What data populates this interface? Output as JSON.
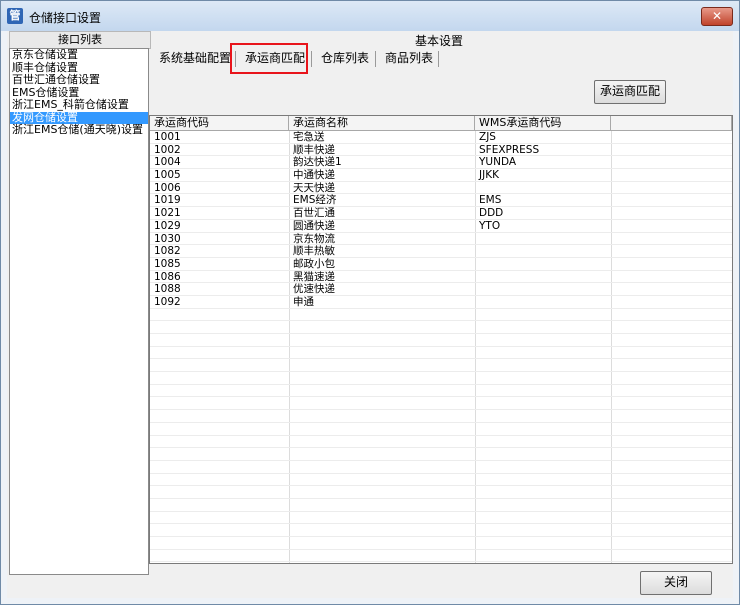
{
  "window": {
    "title": "仓储接口设置",
    "app_icon_glyph": "管",
    "close_glyph": "✕"
  },
  "left_panel": {
    "header": "接口列表",
    "items": [
      {
        "label": "京东仓储设置",
        "selected": false
      },
      {
        "label": "顺丰仓储设置",
        "selected": false
      },
      {
        "label": "百世汇通仓储设置",
        "selected": false
      },
      {
        "label": "EMS仓储设置",
        "selected": false
      },
      {
        "label": "浙江EMS_科箭仓储设置",
        "selected": false
      },
      {
        "label": "发网仓储设置",
        "selected": true
      },
      {
        "label": "浙江EMS仓储(通天晓)设置",
        "selected": false
      }
    ]
  },
  "main": {
    "section_title": "基本设置",
    "tabs": [
      {
        "label": "系统基础配置",
        "active": false
      },
      {
        "label": "承运商匹配",
        "active": true
      },
      {
        "label": "仓库列表",
        "active": false
      },
      {
        "label": "商品列表",
        "active": false
      }
    ],
    "match_button": "承运商匹配",
    "grid": {
      "columns": [
        "承运商代码",
        "承运商名称",
        "WMS承运商代码",
        ""
      ],
      "rows": [
        [
          "1001",
          "宅急送",
          "ZJS"
        ],
        [
          "1002",
          "顺丰快递",
          "SFEXPRESS"
        ],
        [
          "1004",
          "韵达快递1",
          "YUNDA"
        ],
        [
          "1005",
          "中通快递",
          "JJKK"
        ],
        [
          "1006",
          "天天快递",
          ""
        ],
        [
          "1019",
          "EMS经济",
          "EMS"
        ],
        [
          "1021",
          "百世汇通",
          "DDD"
        ],
        [
          "1029",
          "圆通快递",
          "YTO"
        ],
        [
          "1030",
          "京东物流",
          ""
        ],
        [
          "1082",
          "顺丰热敏",
          ""
        ],
        [
          "1085",
          "邮政小包",
          ""
        ],
        [
          "1086",
          "黑猫速递",
          ""
        ],
        [
          "1088",
          "优速快递",
          ""
        ],
        [
          "1092",
          "申通",
          ""
        ]
      ]
    }
  },
  "footer": {
    "close_button": "关闭"
  },
  "colors": {
    "selection": "#3399ff",
    "highlight_border": "#e8141b"
  }
}
